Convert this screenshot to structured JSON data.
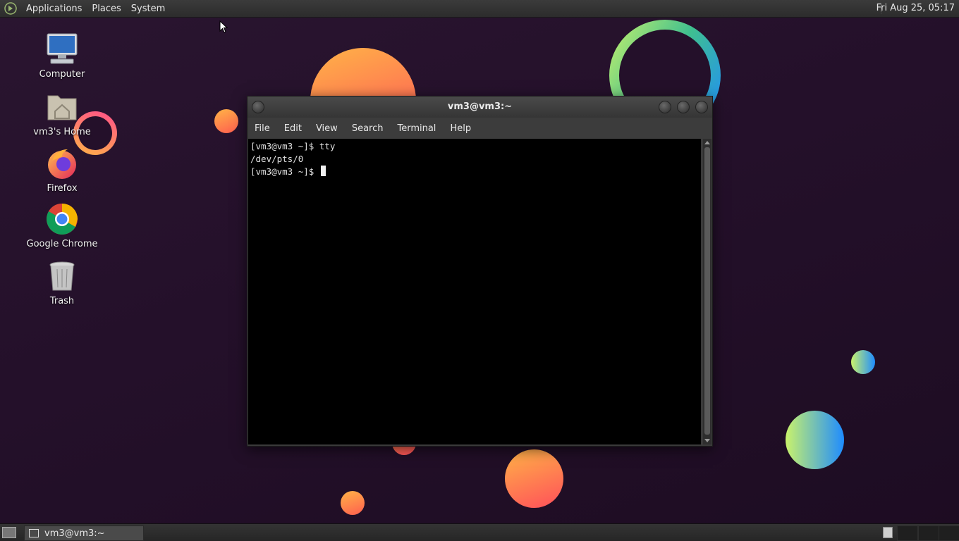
{
  "top_panel": {
    "menus": [
      "Applications",
      "Places",
      "System"
    ],
    "clock": "Fri Aug 25, 05:17"
  },
  "desktop": {
    "icons": [
      {
        "label": "Computer",
        "icon": "computer-icon"
      },
      {
        "label": "vm3's Home",
        "icon": "home-folder-icon"
      },
      {
        "label": "Firefox",
        "icon": "firefox-icon"
      },
      {
        "label": "Google Chrome",
        "icon": "chrome-icon"
      },
      {
        "label": "Trash",
        "icon": "trash-icon"
      }
    ]
  },
  "terminal": {
    "title": "vm3@vm3:~",
    "menu": [
      "File",
      "Edit",
      "View",
      "Search",
      "Terminal",
      "Help"
    ],
    "lines": [
      "[vm3@vm3 ~]$ tty",
      "/dev/pts/0",
      "[vm3@vm3 ~]$ "
    ]
  },
  "bottom_panel": {
    "task_label": "vm3@vm3:~"
  },
  "colors": {
    "desktop_bg": "#24102a",
    "orange_gradient": [
      "#ffb347",
      "#ff4f5a"
    ],
    "green_blue_gradient": [
      "#c9f26b",
      "#1e8cff"
    ]
  }
}
